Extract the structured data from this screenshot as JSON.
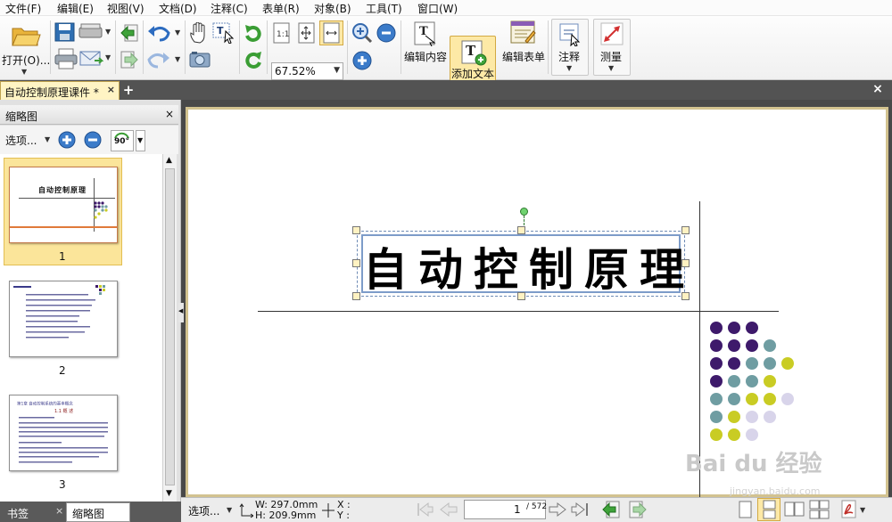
{
  "menu": {
    "items": [
      "文件(F)",
      "编辑(E)",
      "视图(V)",
      "文档(D)",
      "注释(C)",
      "表单(R)",
      "对象(B)",
      "工具(T)",
      "窗口(W)"
    ]
  },
  "toolbar": {
    "open_label": "打开(O)...",
    "zoom_value": "67.52%",
    "edit_content_label": "编辑内容",
    "add_text_label": "添加文本",
    "edit_form_label": "编辑表单",
    "annotate_label": "注释",
    "measure_label": "测量"
  },
  "tabs": {
    "document_tab": "自动控制原理课件 *"
  },
  "thumbnail_panel": {
    "title": "缩略图",
    "options_label": "选项...",
    "rotate_label": "90°",
    "page_numbers": [
      "1",
      "2",
      "3"
    ],
    "thumb1_title": "自动控制原理",
    "thumb3_heading": "第1章 自动控制系统的基本概念",
    "thumb3_subheading": "1.1 概 述"
  },
  "bottom_tabs": {
    "bookmarks": "书签",
    "thumbnails": "缩略图"
  },
  "document": {
    "title_text": "自动控制原理"
  },
  "status": {
    "options_label": "选项...",
    "width": "W: 297.0mm",
    "height": "H: 209.9mm",
    "x_label": "X :",
    "y_label": "Y :",
    "current_page": "1",
    "total_pages": "/ 572"
  },
  "watermark": {
    "brand": "Bai du 经验",
    "url": "jingyan.baidu.com"
  },
  "colors": {
    "tab_bar": "#535353",
    "active_tab": "#fff4c4",
    "highlight": "#fde9a6",
    "dot_purple": "#3e1a6b",
    "dot_teal": "#6f9da2",
    "dot_yellow": "#c9cc24",
    "dot_lavender": "#d8d4ea"
  },
  "icons": [
    "open-folder-icon",
    "save-icon",
    "scanner-icon",
    "print-icon",
    "email-icon",
    "back-icon",
    "forward-icon",
    "undo-icon",
    "redo-icon",
    "hand-icon",
    "select-text-icon",
    "snapshot-icon",
    "rotate-cw-icon",
    "rotate-ccw-icon",
    "actual-size-icon",
    "fit-page-icon",
    "fit-width-icon",
    "zoom-in-icon",
    "zoom-out-icon"
  ]
}
